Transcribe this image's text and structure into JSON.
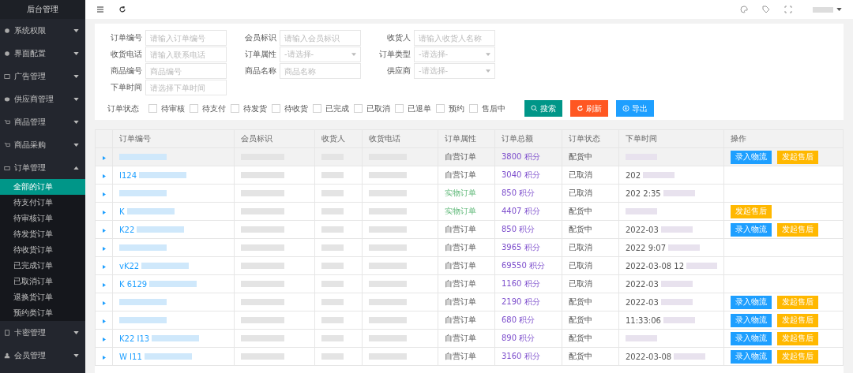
{
  "sidebar": {
    "title": "后台管理",
    "items": [
      {
        "label": "系统权限",
        "kind": "gear",
        "expanded": false
      },
      {
        "label": "界面配置",
        "kind": "gear",
        "expanded": false
      },
      {
        "label": "广告管理",
        "kind": "image",
        "expanded": false
      },
      {
        "label": "供应商管理",
        "kind": "stack",
        "expanded": false
      },
      {
        "label": "商品管理",
        "kind": "cart",
        "expanded": false
      },
      {
        "label": "商品采购",
        "kind": "cart",
        "expanded": false
      },
      {
        "label": "订单管理",
        "kind": "printer",
        "expanded": true,
        "children": [
          {
            "label": "全部的订单",
            "selected": true
          },
          {
            "label": "待支付订单",
            "selected": false
          },
          {
            "label": "待审核订单",
            "selected": false
          },
          {
            "label": "待发货订单",
            "selected": false
          },
          {
            "label": "待收货订单",
            "selected": false
          },
          {
            "label": "已完成订单",
            "selected": false
          },
          {
            "label": "已取消订单",
            "selected": false
          },
          {
            "label": "退换货订单",
            "selected": false
          },
          {
            "label": "预约类订单",
            "selected": false
          }
        ]
      },
      {
        "label": "卡密管理",
        "kind": "card",
        "expanded": false
      },
      {
        "label": "会员管理",
        "kind": "users",
        "expanded": false
      }
    ]
  },
  "filters": {
    "fields": [
      {
        "label": "订单编号",
        "kind": "input",
        "placeholder": "请输入订单编号"
      },
      {
        "label": "会员标识",
        "kind": "input",
        "placeholder": "请输入会员标识"
      },
      {
        "label": "收货人",
        "kind": "input",
        "placeholder": "请输入收货人名称"
      },
      {
        "label": "收货电话",
        "kind": "input",
        "placeholder": "请输入联系电话"
      },
      {
        "label": "订单属性",
        "kind": "select",
        "placeholder": "-请选择-"
      },
      {
        "label": "订单类型",
        "kind": "select",
        "placeholder": "-请选择-"
      },
      {
        "label": "商品编号",
        "kind": "input",
        "placeholder": "商品编号"
      },
      {
        "label": "商品名称",
        "kind": "input",
        "placeholder": "商品名称"
      },
      {
        "label": "供应商",
        "kind": "select",
        "placeholder": "-请选择-"
      },
      {
        "label": "下单时间",
        "kind": "input",
        "placeholder": "请选择下单时间"
      }
    ],
    "status_label": "订单状态",
    "statuses": [
      {
        "label": "待审核",
        "checked": false
      },
      {
        "label": "待支付",
        "checked": false
      },
      {
        "label": "待发货",
        "checked": false
      },
      {
        "label": "待收货",
        "checked": false
      },
      {
        "label": "已完成",
        "checked": false
      },
      {
        "label": "已取消",
        "checked": false
      },
      {
        "label": "已退单",
        "checked": false
      },
      {
        "label": "预约",
        "checked": false
      },
      {
        "label": "售后中",
        "checked": false
      }
    ],
    "buttons": [
      {
        "label": "搜索",
        "kind": "search"
      },
      {
        "label": "刷新",
        "kind": "refresh"
      },
      {
        "label": "导出",
        "kind": "export"
      }
    ]
  },
  "table": {
    "columns": [
      "订单编号",
      "会员标识",
      "收货人",
      "收货电话",
      "订单属性",
      "订单总额",
      "订单状态",
      "下单时间",
      "操作"
    ],
    "rows": [
      {
        "selected": true,
        "attr": "自营订单",
        "physical": false,
        "total": "3800 积分",
        "status": "配货中",
        "actions": [
          {
            "label": "录入物流",
            "kind": "primary"
          },
          {
            "label": "发起售后",
            "kind": "warning"
          }
        ]
      },
      {
        "selected": false,
        "order_no": "I124",
        "attr": "自营订单",
        "physical": false,
        "total": "3040 积分",
        "status": "已取消",
        "time": "202",
        "actions": []
      },
      {
        "selected": false,
        "attr": "实物订单",
        "physical": true,
        "total": "850 积分",
        "status": "已取消",
        "time": "202 2:35",
        "actions": []
      },
      {
        "selected": false,
        "order_no": "K",
        "attr": "实物订单",
        "physical": true,
        "total": "4407 积分",
        "status": "配货中",
        "actions": [
          {
            "label": "发起售后",
            "kind": "warning"
          }
        ]
      },
      {
        "selected": false,
        "order_no": "K22",
        "attr": "自营订单",
        "physical": false,
        "total": "850 积分",
        "status": "配货中",
        "time": "2022-03",
        "actions": [
          {
            "label": "录入物流",
            "kind": "primary"
          },
          {
            "label": "发起售后",
            "kind": "warning"
          }
        ]
      },
      {
        "selected": false,
        "attr": "自营订单",
        "physical": false,
        "total": "3965 积分",
        "status": "已取消",
        "time": "2022 9:07",
        "actions": []
      },
      {
        "selected": false,
        "order_no": "vK22",
        "attr": "自营订单",
        "physical": false,
        "total": "69550 积分",
        "status": "已取消",
        "time": "2022-03-08 12",
        "actions": []
      },
      {
        "selected": false,
        "order_no": "K 6129",
        "attr": "自营订单",
        "physical": false,
        "total": "1160 积分",
        "status": "已取消",
        "time": "2022-03",
        "actions": []
      },
      {
        "selected": false,
        "attr": "自营订单",
        "physical": false,
        "total": "2190 积分",
        "status": "配货中",
        "time": "2022-03",
        "actions": [
          {
            "label": "录入物流",
            "kind": "primary"
          },
          {
            "label": "发起售后",
            "kind": "warning"
          }
        ]
      },
      {
        "selected": false,
        "attr": "自营订单",
        "physical": false,
        "total": "680 积分",
        "status": "配货中",
        "time": "11:33:06",
        "actions": [
          {
            "label": "录入物流",
            "kind": "primary"
          },
          {
            "label": "发起售后",
            "kind": "warning"
          }
        ]
      },
      {
        "selected": false,
        "order_no": "K22 I13",
        "attr": "自营订单",
        "physical": false,
        "total": "890 积分",
        "status": "配货中",
        "actions": [
          {
            "label": "录入物流",
            "kind": "primary"
          },
          {
            "label": "发起售后",
            "kind": "warning"
          }
        ]
      },
      {
        "selected": false,
        "order_no": "W I11",
        "attr": "自营订单",
        "physical": false,
        "total": "3160 积分",
        "status": "配货中",
        "time": "2022-03-08",
        "actions": [
          {
            "label": "录入物流",
            "kind": "primary"
          },
          {
            "label": "发起售后",
            "kind": "warning"
          }
        ]
      }
    ]
  }
}
